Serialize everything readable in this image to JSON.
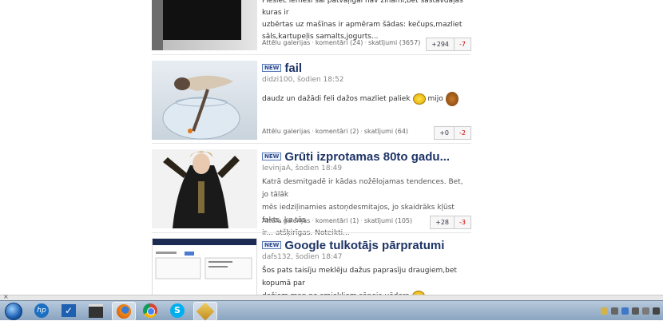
{
  "posts": [
    {
      "title": "",
      "author_line": "",
      "body_lines": [
        "Pieslēc lēmēsi šai patvaļīgai nav zināmi,bet sastāvdaļas kuras ir",
        "uzbērtas uz mašīnas ir apmēram šādas: kečups,mazliet",
        "sāls,kartupeļis samalts,jogurts..."
      ],
      "gallery_link": "Attēlu galerijas",
      "comments": "komentāri (24)",
      "views": "skatījumi (3657)",
      "plus": "+294",
      "minus": "-7"
    },
    {
      "badge": "NEW",
      "title": "fail",
      "author_line": "didzi100, šodien 18:52",
      "body_lines": [
        "daudz un dažādi feli dažos mazliet paliek",
        "mijo"
      ],
      "gallery_link": "Attēlu galerijas",
      "comments": "komentāri (2)",
      "views": "skatījumi (64)",
      "plus": "+0",
      "minus": "-2"
    },
    {
      "badge": "NEW",
      "title": "Grūti izprotamas 80to gadu...",
      "author_line": "IevinjaA, šodien 18:49",
      "body_lines": [
        "Katrā desmitgadē ir kādas nožēlojamas tendences. Bet, jo tālāk",
        "mēs iedziļinamies astoņdesmitajos, jo skaidrāks kļūst fakts, ka tās",
        "ir... atšķirīgas. Noteikti..."
      ],
      "gallery_link": "Attēlu galerijas",
      "comments": "komentāri (1)",
      "views": "skatījumi (105)",
      "plus": "+28",
      "minus": "-3"
    },
    {
      "badge": "NEW",
      "title": "Google tulkotājs pārpratumi",
      "author_line": "dafs132, šodien 18:47",
      "body_lines": [
        "Šos pats taisīju meklēju dažus paprasīju draugiem,bet kopumā par",
        "dažiem man no smiekliem sāpeja vēders"
      ]
    }
  ],
  "icons": {
    "start": "windows-start-icon",
    "hp": "hp-icon",
    "check": "checkmark-app-icon",
    "film": "film-clapper-icon",
    "firefox": "firefox-icon",
    "chrome": "chrome-icon",
    "skype": "skype-icon",
    "tool": "tool-app-icon"
  },
  "colors": {
    "title": "#1d3466",
    "minus": "#cc0000",
    "taskbar": "#9fb5cd"
  }
}
